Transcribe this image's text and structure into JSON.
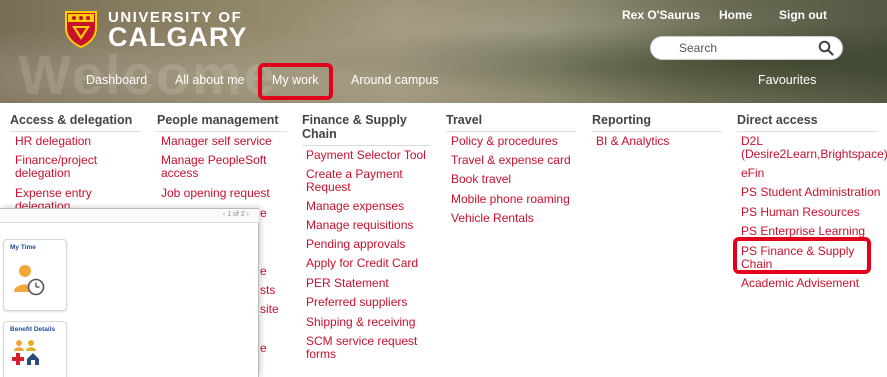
{
  "header": {
    "watermark": "Welcome",
    "logo_top": "UNIVERSITY OF",
    "logo_main": "CALGARY",
    "user_name": "Rex O'Saurus",
    "home": "Home",
    "sign_out": "Sign out",
    "search_placeholder": "Search",
    "nav": [
      "Dashboard",
      "All about me",
      "My work",
      "Around campus"
    ],
    "favourites": "Favourites"
  },
  "menu": {
    "columns": [
      {
        "title": "Access & delegation",
        "links": [
          "HR delegation",
          "Finance/project delegation",
          "Expense entry delegation"
        ]
      },
      {
        "title": "People management",
        "links": [
          "Manager self service",
          "Manage PeopleSoft access",
          "Job opening request"
        ]
      },
      {
        "title": "Finance & Supply Chain",
        "links": [
          "Payment Selector Tool",
          "Create a Payment Request",
          "Manage expenses",
          "Manage requisitions",
          "Pending approvals",
          "Apply for Credit Card",
          "PER Statement",
          "Preferred suppliers",
          "Shipping & receiving",
          "SCM service request forms"
        ]
      },
      {
        "title": "Travel",
        "links": [
          "Policy & procedures",
          "Travel & expense card",
          "Book travel",
          "Mobile phone roaming",
          "Vehicle Rentals"
        ]
      },
      {
        "title": "Reporting",
        "links": [
          "BI & Analytics"
        ]
      },
      {
        "title": "Direct access",
        "links": [
          "D2L (Desire2Learn,Brightspace)",
          "eFin",
          "PS Student Administration",
          "PS Human Resources",
          "PS Enterprise Learning",
          "PS Finance & Supply Chain",
          "Academic Advisement"
        ]
      }
    ],
    "peek_fragments": [
      "e",
      "e",
      "sts",
      "site",
      "e"
    ]
  },
  "overlay": {
    "pager": "‹ 1 of 2 ›",
    "tiles": [
      {
        "title": "My Time"
      },
      {
        "title": "Benefit Details"
      }
    ]
  },
  "colors": {
    "link": "#c8102e",
    "highlight": "#e3001b",
    "tile_title": "#1f4e95"
  }
}
